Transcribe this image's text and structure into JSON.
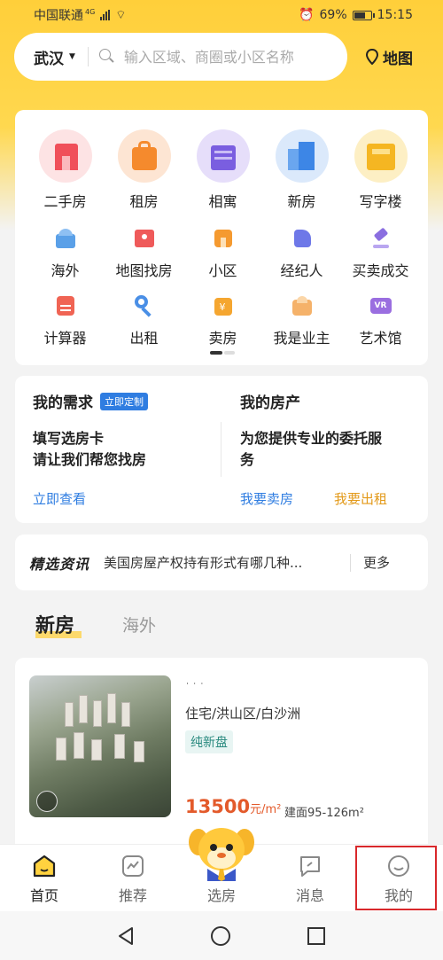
{
  "status_bar": {
    "carrier": "中国联通",
    "network": "4G",
    "battery": "69%",
    "time": "15:15"
  },
  "search": {
    "city": "武汉",
    "placeholder": "输入区域、商圈或小区名称",
    "map_label": "地图"
  },
  "categories": {
    "row1": [
      {
        "label": "二手房",
        "icon": "second-hand-house-icon",
        "color": "#f0505a"
      },
      {
        "label": "租房",
        "icon": "rent-icon",
        "color": "#f58a2d"
      },
      {
        "label": "相寓",
        "icon": "apartment-icon",
        "color": "#7a5ee0"
      },
      {
        "label": "新房",
        "icon": "new-house-icon",
        "color": "#3d86e6"
      },
      {
        "label": "写字楼",
        "icon": "office-icon",
        "color": "#f5b622"
      }
    ],
    "row2": [
      {
        "label": "海外",
        "icon": "overseas-icon",
        "color": "#5aa0e8"
      },
      {
        "label": "地图找房",
        "icon": "map-search-icon",
        "color": "#ef5a5a"
      },
      {
        "label": "小区",
        "icon": "community-icon",
        "color": "#f59a30"
      },
      {
        "label": "经纪人",
        "icon": "agent-icon",
        "color": "#6e78e8"
      },
      {
        "label": "买卖成交",
        "icon": "deal-hammer-icon",
        "color": "#8a6ee0"
      }
    ],
    "row3": [
      {
        "label": "计算器",
        "icon": "calculator-icon",
        "color": "#f06454"
      },
      {
        "label": "出租",
        "icon": "lease-key-icon",
        "color": "#4a8fe6"
      },
      {
        "label": "卖房",
        "icon": "sell-house-icon",
        "color": "#f5a630"
      },
      {
        "label": "我是业主",
        "icon": "owner-icon",
        "color": "#f5b26a"
      },
      {
        "label": "艺术馆",
        "icon": "vr-gallery-icon",
        "color": "#9a6ee0"
      }
    ]
  },
  "demand": {
    "left_title": "我的需求",
    "left_badge": "立即定制",
    "left_line1": "填写选房卡",
    "left_line2": "请让我们帮您找房",
    "left_link": "立即查看",
    "right_title": "我的房产",
    "right_line1": "为您提供专业的委托服",
    "right_line2": "务",
    "right_link1": "我要卖房",
    "right_link2": "我要出租"
  },
  "news": {
    "brand": "精选资讯",
    "headline": "美国房屋产权持有形式有哪几种...",
    "more": "更多"
  },
  "tabs": {
    "active": "新房",
    "inactive": "海外"
  },
  "listing": {
    "type": "住宅/洪山区/白沙洲",
    "tag": "纯新盘",
    "price": "13500",
    "price_unit": "元/m²",
    "area": "建面95-126m²"
  },
  "bottom_nav": [
    {
      "label": "首页",
      "icon": "home-icon"
    },
    {
      "label": "推荐",
      "icon": "recommend-icon"
    },
    {
      "label": "选房",
      "icon": "mascot-icon"
    },
    {
      "label": "消息",
      "icon": "message-icon"
    },
    {
      "label": "我的",
      "icon": "profile-icon"
    }
  ],
  "colors": {
    "brand_yellow": "#ffd23f",
    "link_blue": "#2f7de1",
    "link_orange": "#e39a1a",
    "price_red": "#e35a2b",
    "highlight_red": "#d9282b"
  }
}
